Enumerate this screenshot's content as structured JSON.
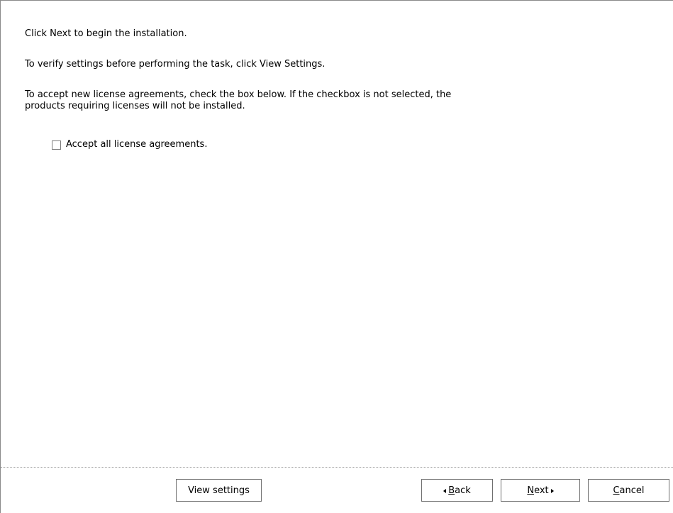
{
  "intro": {
    "line1": "Click Next to begin the installation.",
    "line2": "To verify settings before performing the task, click View Settings.",
    "line3a": "To accept new license agreements, check the box below. If the checkbox is not selected, the",
    "line3b": "products requiring licenses will not be installed."
  },
  "license": {
    "checkbox_label": "Accept all license agreements.",
    "checked": false
  },
  "buttons": {
    "view_settings": "View settings",
    "back_mnemonic": "B",
    "back_rest": "ack",
    "next_mnemonic": "N",
    "next_rest": "ext",
    "cancel_mnemonic": "C",
    "cancel_rest": "ancel"
  },
  "icons": {
    "back": "arrow-left-icon",
    "next": "arrow-right-icon"
  }
}
